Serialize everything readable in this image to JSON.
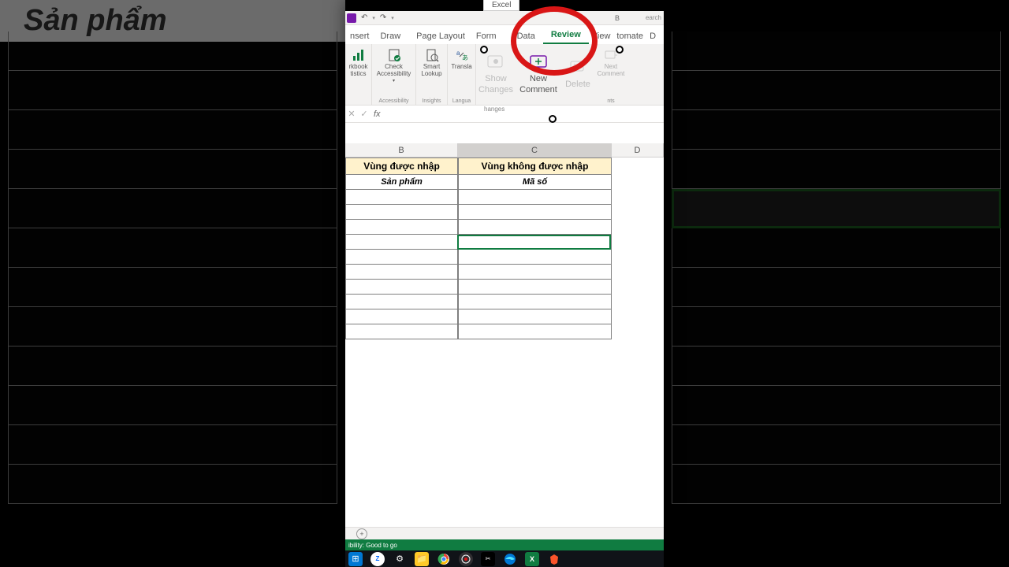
{
  "app": {
    "name": "Excel"
  },
  "qat": {
    "undo": "↶",
    "redo": "↷",
    "searchHint": "earch",
    "buttonHint": "B"
  },
  "tabs": {
    "items": [
      "nsert",
      "Draw",
      "Page Layout",
      "Form",
      "Data",
      "Review",
      "View",
      "tomate",
      "D"
    ],
    "activeIndex": 5
  },
  "ribbon": {
    "workbook": "rkbook\ntistics",
    "checkAcc": "Check\nAccessibility",
    "accGroup": "Accessibility",
    "smart": "Smart\nLookup",
    "insights": "Insights",
    "translate": "Transla",
    "lang": "Langua",
    "showChanges": "Show\nChanges",
    "changes": "hanges",
    "newComment": "New\nComment",
    "delete": "Delete",
    "nextComment": "Next\nComment",
    "comments": "nts"
  },
  "formulabar": {
    "value": ""
  },
  "columns": {
    "B": "B",
    "C": "C",
    "D": "D"
  },
  "sheet": {
    "headerB": "Vùng được nhập",
    "headerC": "Vùng không được nhập",
    "sub_B": "Sản phẩm",
    "sub_C": "Mã số",
    "blankRows": 10
  },
  "bg": {
    "bigtext": "Sản phẩm"
  },
  "status": {
    "text": "ibility: Good to go"
  },
  "taskbar": {
    "icons": [
      "win",
      "zalo",
      "settings",
      "files",
      "chrome",
      "obs",
      "capcut",
      "edge",
      "excel",
      "brave"
    ]
  }
}
